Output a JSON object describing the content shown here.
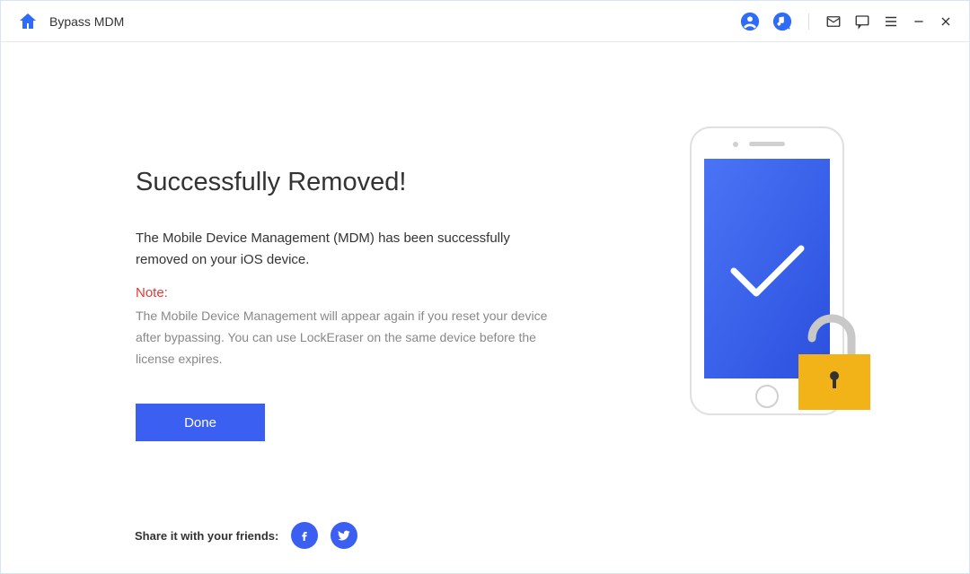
{
  "header": {
    "title": "Bypass MDM"
  },
  "main": {
    "heading": "Successfully Removed!",
    "description": "The Mobile Device Management (MDM) has been successfully removed on your iOS device.",
    "note_label": "Note:",
    "note_text": "The Mobile Device Management will appear again if you reset your device after bypassing. You can use LockEraser on the same device before the license expires.",
    "done_label": "Done"
  },
  "footer": {
    "share_label": "Share it with your friends:"
  }
}
